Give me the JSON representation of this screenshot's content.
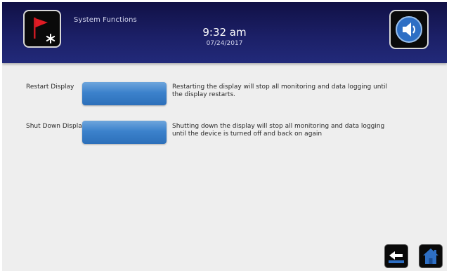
{
  "header": {
    "title": "System Functions",
    "time": "9:32 am",
    "date": "07/24/2017",
    "app_icon": "flag-alarm-icon",
    "sound_icon": "speaker-icon"
  },
  "rows": [
    {
      "label": "Restart Display",
      "description": "Restarting the display will stop all monitoring and data logging until the display restarts."
    },
    {
      "label": "Shut Down Display",
      "description": "Shutting down the display will stop all monitoring and data logging until the device is turned off and back on again"
    }
  ],
  "footer": {
    "back_icon": "back-arrow-icon",
    "home_icon": "home-icon"
  },
  "colors": {
    "header_bg": "#1b1f66",
    "button_blue": "#3c82cc",
    "flag_red": "#e01b24",
    "speaker_blue": "#2e6fc4"
  }
}
